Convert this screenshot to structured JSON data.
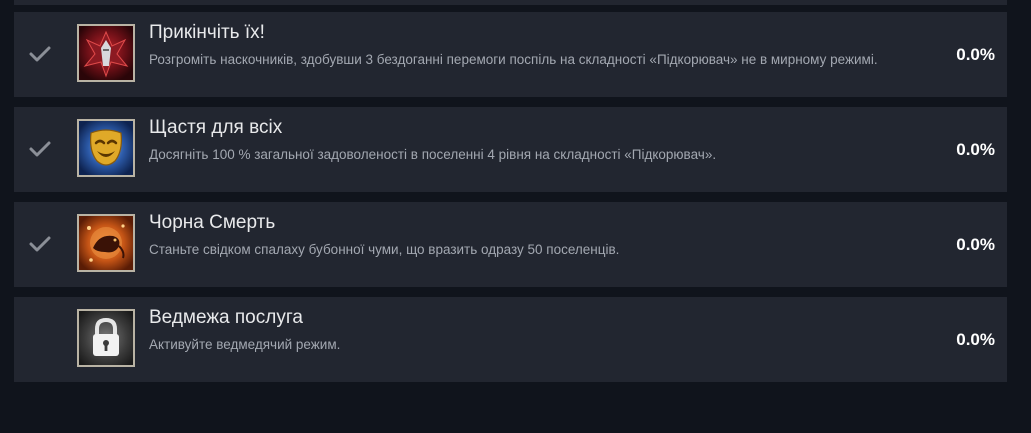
{
  "achievements": [
    {
      "title": "Прикінчіть їх!",
      "description": "Розгроміть наскочників, здобувши 3 бездоганні перемоги поспіль на складності «Підкорювач» не в мирному режимі.",
      "percent": "0.0%",
      "unlocked": true,
      "icon": "crimson-warrior-icon"
    },
    {
      "title": "Щастя для всіх",
      "description": "Досягніть 100 % загальної задоволеності в поселенні 4 рівня на складності «Підкорювач».",
      "percent": "0.0%",
      "unlocked": true,
      "icon": "golden-mask-icon"
    },
    {
      "title": "Чорна Смерть",
      "description": "Станьте свідком спалаху бубонної чуми, що вразить одразу 50 поселенців.",
      "percent": "0.0%",
      "unlocked": true,
      "icon": "plague-rat-icon"
    },
    {
      "title": "Ведмежа послуга",
      "description": "Активуйте ведмедячий режим.",
      "percent": "0.0%",
      "unlocked": false,
      "icon": "padlock-icon"
    }
  ],
  "colors": {
    "background": "#10141c",
    "row": "#222630",
    "title": "#e8e9eb",
    "description": "#a3a8b1",
    "percent": "#ffffff",
    "checkmark": "#8b8f97"
  }
}
